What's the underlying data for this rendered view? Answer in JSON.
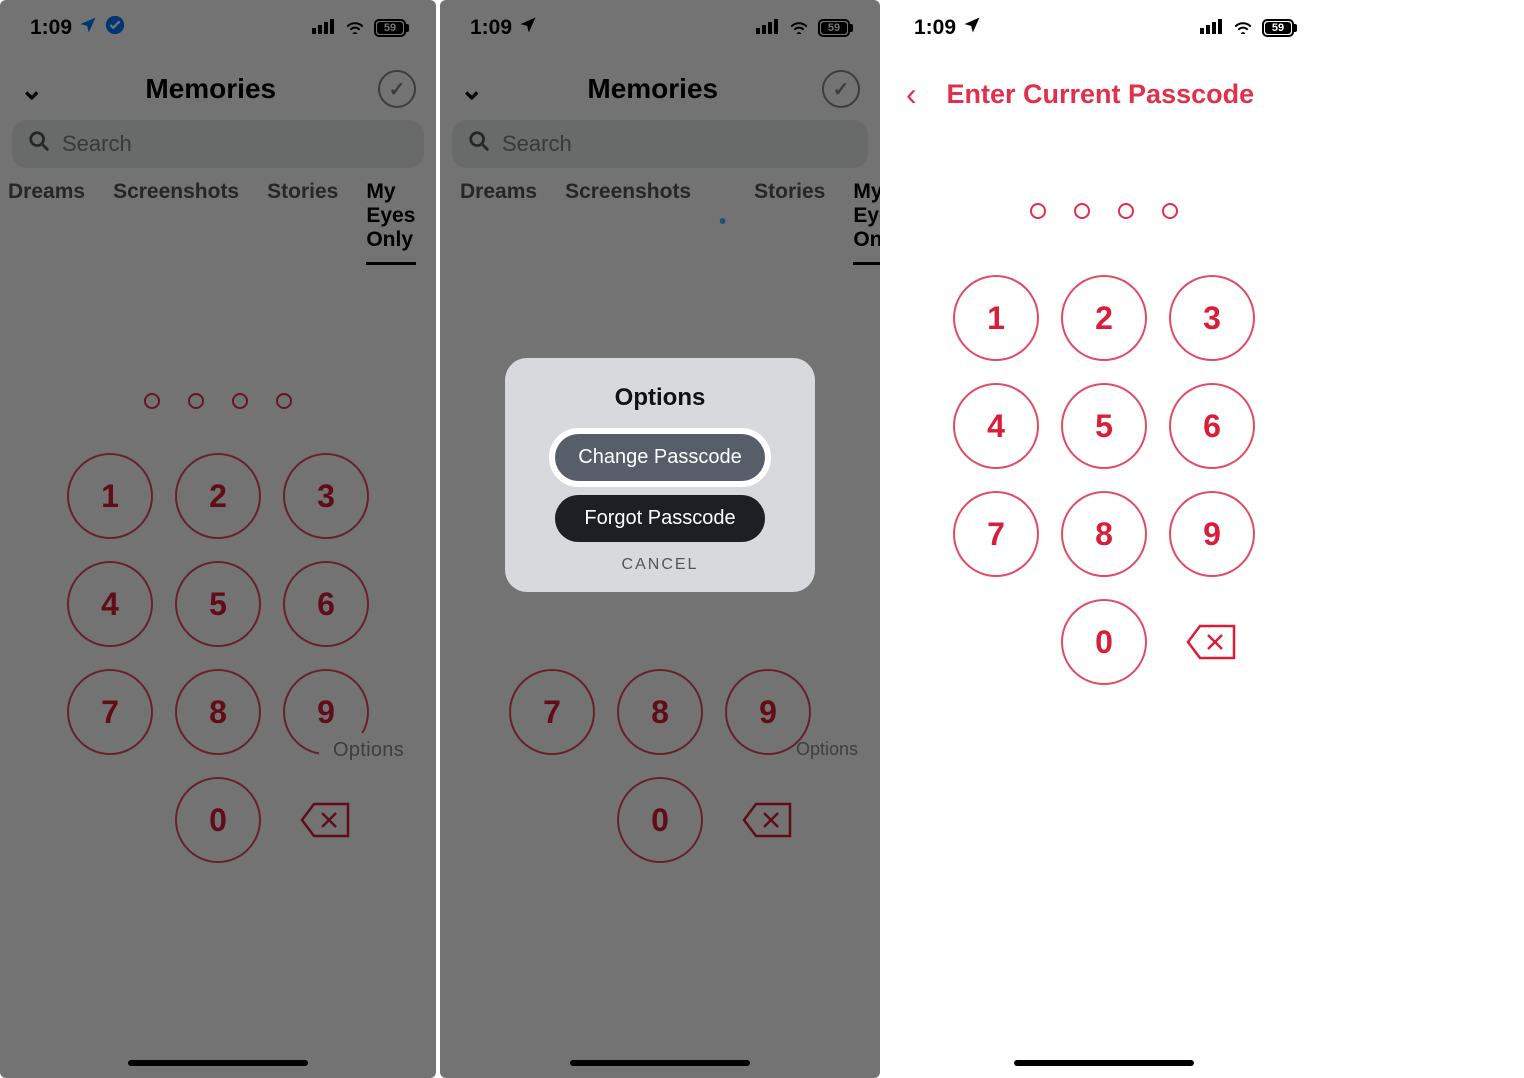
{
  "status": {
    "time": "1:09",
    "battery_label": "59"
  },
  "memories": {
    "title": "Memories",
    "search_placeholder": "Search",
    "tabs": [
      "Dreams",
      "Screenshots",
      "Stories",
      "My Eyes Only"
    ],
    "options_label": "Options"
  },
  "keypad": [
    "1",
    "2",
    "3",
    "4",
    "5",
    "6",
    "7",
    "8",
    "9",
    "",
    "0",
    "⌫"
  ],
  "modal": {
    "title": "Options",
    "change": "Change Passcode",
    "forgot": "Forgot Passcode",
    "cancel": "CANCEL"
  },
  "enter": {
    "title": "Enter Current Passcode"
  }
}
